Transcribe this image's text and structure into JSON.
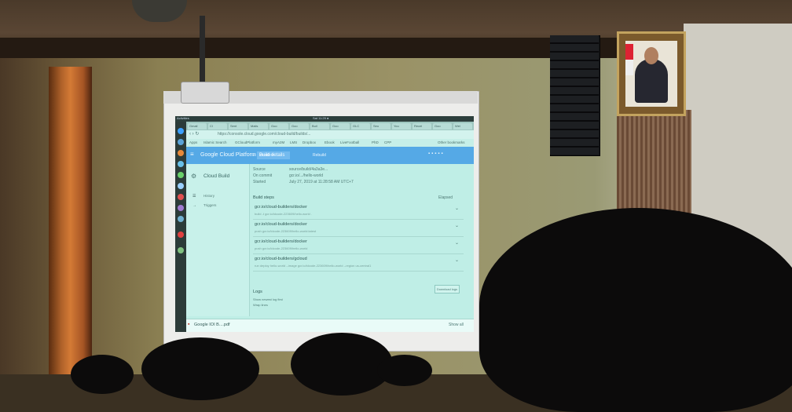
{
  "screen": {
    "clock": "Sat 11:29 ●",
    "launcher": "Activities",
    "url": "https://console.cloud.google.com/cloud-build/builds/...",
    "bookmarks": [
      "Apps",
      "Islamic Search",
      "GCloudPlatform",
      "myA2M",
      "LMS",
      "Dropbox",
      "Ebook",
      "LiveFootball",
      "PhD",
      "CPP"
    ],
    "other_bookmarks": "Other bookmarks",
    "tabs": [
      "Gmail",
      "Cl",
      "Sent",
      "Mails",
      "Goo",
      "Goo",
      "Buil",
      "Goo",
      "GLC",
      "Seo",
      "You",
      "Recei",
      "Goo",
      "Wel"
    ],
    "gcp_title": "Google Cloud Platform",
    "project": "idcode ▾",
    "page_title": "Build details",
    "rebuild": "Rebuild",
    "sidebar": {
      "title": "Cloud Build",
      "items": [
        "History",
        "Triggers"
      ]
    },
    "meta": [
      {
        "label": "Source",
        "value": "source/build/4a3a3e..."
      },
      {
        "label": "On commit",
        "value": "gcr.io/.../hello-world"
      },
      {
        "label": "Started",
        "value": "July 27, 2019 at 11:28:58 AM UTC+7"
      }
    ],
    "build_steps_label": "Build steps",
    "elapsed_label": "Elapsed",
    "steps": [
      {
        "name": "gcr.io/cloud-builders/docker",
        "args": "build -t gcr.io/idcode-223609/hello-world ."
      },
      {
        "name": "gcr.io/cloud-builders/docker",
        "args": "push gcr.io/idcode-223609/hello-world:latest"
      },
      {
        "name": "gcr.io/cloud-builders/docker",
        "args": "push gcr.io/idcode-223609/hello-world"
      },
      {
        "name": "gcr.io/cloud-builders/gcloud",
        "args": "run deploy hello-world --image gcr.io/idcode-223609/hello-world --region us-central1"
      }
    ],
    "download_logs": "Download logs",
    "logs_label": "Logs",
    "log_options": [
      "Show newest log first",
      "Wrap lines"
    ],
    "download_item": "Google IOI B....pdf",
    "show_all": "Show all"
  }
}
